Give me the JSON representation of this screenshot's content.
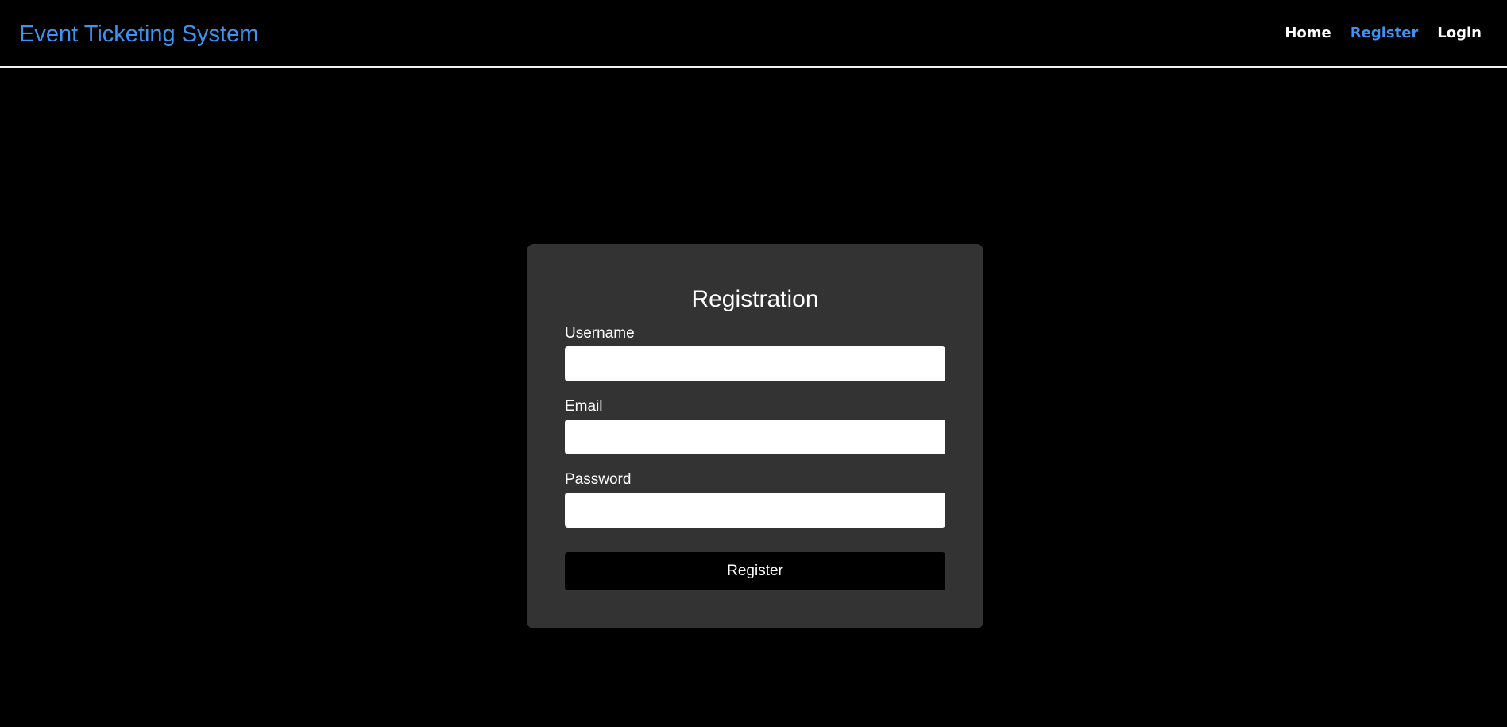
{
  "header": {
    "brand": "Event Ticketing System",
    "nav": [
      {
        "label": "Home",
        "active": false
      },
      {
        "label": "Register",
        "active": true
      },
      {
        "label": "Login",
        "active": false
      }
    ]
  },
  "form": {
    "title": "Registration",
    "fields": [
      {
        "label": "Username",
        "value": "",
        "placeholder": ""
      },
      {
        "label": "Email",
        "value": "",
        "placeholder": ""
      },
      {
        "label": "Password",
        "value": "",
        "placeholder": ""
      }
    ],
    "submit_label": "Register"
  },
  "colors": {
    "accent": "#3b93f3",
    "background": "#000000",
    "card": "#333333"
  }
}
